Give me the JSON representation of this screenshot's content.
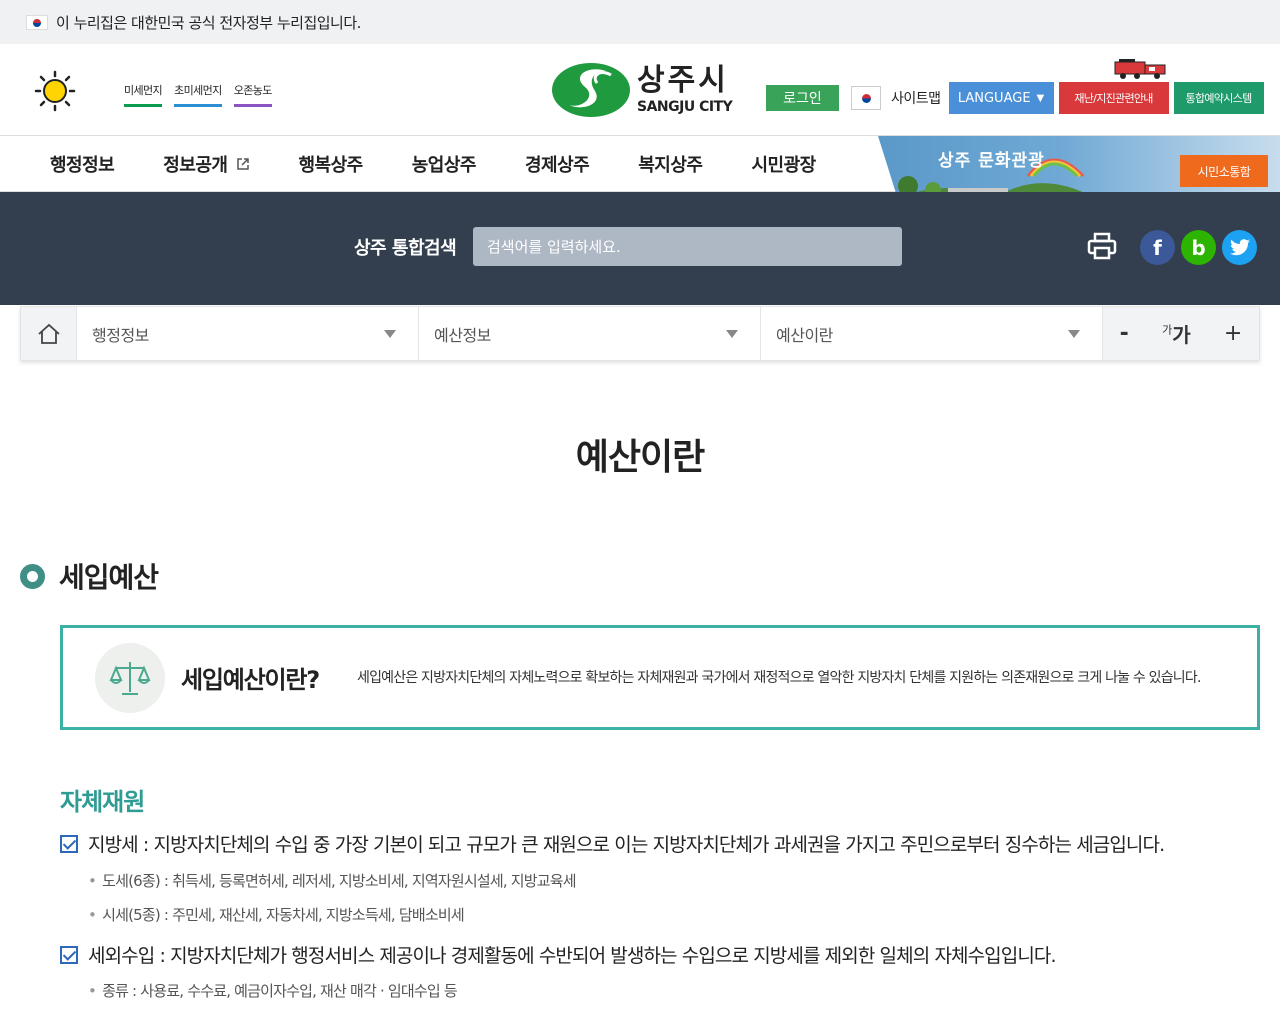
{
  "gov_banner": "이 누리집은 대한민국 공식 전자정부 누리집입니다.",
  "air": [
    "미세먼지",
    "초미세먼지",
    "오존농도"
  ],
  "logo": {
    "ko": "상주시",
    "en": "SANGJU CITY"
  },
  "header": {
    "login": "로그인",
    "sitemap": "사이트맵",
    "language": "LANGUAGE",
    "disaster": "재난/지진관련안내",
    "reserve": "통합예약시스템"
  },
  "nav": [
    "행정정보",
    "정보공개",
    "행복상주",
    "농업상주",
    "경제상주",
    "복지상주",
    "시민광장"
  ],
  "banner": {
    "title": "상주 문화관광",
    "button": "시민소통함"
  },
  "search": {
    "label": "상주 통합검색",
    "placeholder": "검색어를 입력하세요."
  },
  "breadcrumb": [
    "행정정보",
    "예산정보",
    "예산이란"
  ],
  "font_tools": {
    "minus": "-",
    "ga_small": "가",
    "ga_big": "가",
    "plus": "+"
  },
  "page_title": "예산이란",
  "section_title": "세입예산",
  "info": {
    "head": "세입예산이란?",
    "text": "세입예산은 지방자치단체의 자체노력으로 확보하는 자체재원과 국가에서 재정적으로 열악한 지방자치 단체를 지원하는 의존재원으로 크게 나눌 수 있습니다."
  },
  "own_revenue": {
    "title": "자체재원",
    "items": [
      {
        "text": "지방세 : 지방자치단체의 수입 중 가장 기본이 되고 규모가 큰 재원으로 이는 지방자치단체가 과세권을 가지고 주민으로부터 징수하는 세금입니다.",
        "bullets": [
          "도세(6종) : 취득세, 등록면허세, 레저세, 지방소비세, 지역자원시설세, 지방교육세",
          "시세(5종) : 주민세, 재산세, 자동차세, 지방소득세, 담배소비세"
        ]
      },
      {
        "text": "세외수입 : 지방자치단체가 행정서비스 제공이나 경제활동에 수반되어 발생하는 수입으로 지방세를 제외한 일체의 자체수입입니다.",
        "bullets": [
          "종류 : 사용료, 수수료, 예금이자수입, 재산 매각 · 임대수입 등"
        ]
      }
    ]
  },
  "colors": {
    "dark_band": "#333f4e",
    "teal": "#3eb1a6",
    "green": "#3aa35a",
    "red": "#d9393b",
    "orange": "#f06a1e"
  },
  "social": [
    "facebook-icon",
    "blog-icon",
    "twitter-icon"
  ]
}
